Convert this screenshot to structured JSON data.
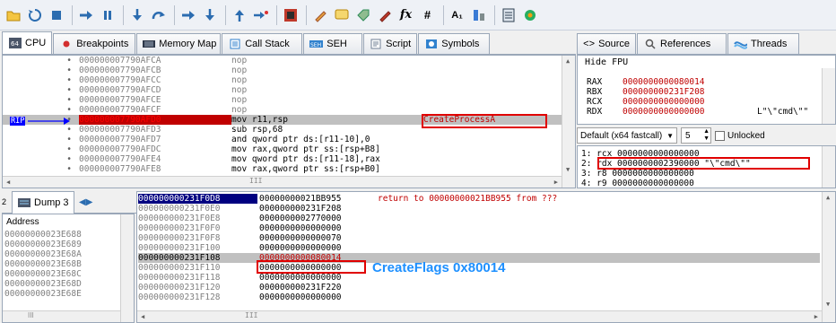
{
  "toolbar": {
    "icons": [
      "open-icon",
      "restart-icon",
      "stop-icon",
      "run-icon",
      "pause-icon",
      "step-into-icon",
      "step-over-icon",
      "trace-into-icon",
      "trace-over-icon",
      "execute-till-return-icon",
      "run-to-user-code-icon",
      "scylla-icon",
      "patch-icon",
      "comment-icon",
      "label-icon",
      "bookmark-icon",
      "function-icon",
      "hash-icon",
      "font-icon",
      "strings-icon",
      "memory-icon",
      "settings-icon"
    ],
    "fx_label": "fx",
    "hash_label": "#",
    "font_label": "A₁"
  },
  "top_tabs": [
    {
      "label": "CPU",
      "icon": "cpu-icon",
      "active": true
    },
    {
      "label": "Breakpoints",
      "icon": "breakpoint-dot-icon"
    },
    {
      "label": "Memory Map",
      "icon": "memory-map-icon"
    },
    {
      "label": "Call Stack",
      "icon": "call-stack-icon"
    },
    {
      "label": "SEH",
      "icon": "seh-icon"
    },
    {
      "label": "Script",
      "icon": "script-icon"
    },
    {
      "label": "Symbols",
      "icon": "symbols-icon"
    },
    {
      "label": "Source",
      "icon": "source-icon"
    },
    {
      "label": "References",
      "icon": "references-icon"
    },
    {
      "label": "Threads",
      "icon": "threads-icon"
    }
  ],
  "disassembly": {
    "rip_label": "RIP",
    "rows": [
      {
        "addr": "000000007790AFCA",
        "instr": "nop",
        "comment": ""
      },
      {
        "addr": "000000007790AFCB",
        "instr": "nop",
        "comment": ""
      },
      {
        "addr": "000000007790AFCC",
        "instr": "nop",
        "comment": ""
      },
      {
        "addr": "000000007790AFCD",
        "instr": "nop",
        "comment": ""
      },
      {
        "addr": "000000007790AFCE",
        "instr": "nop",
        "comment": ""
      },
      {
        "addr": "000000007790AFCF",
        "instr": "nop",
        "comment": ""
      },
      {
        "addr": "000000007790AFD0",
        "instr": "mov r11,rsp",
        "comment": "CreateProcessA",
        "current": true
      },
      {
        "addr": "000000007790AFD3",
        "instr": "sub rsp,68",
        "comment": ""
      },
      {
        "addr": "000000007790AFD7",
        "instr": "and qword ptr ds:[r11-10],0",
        "comment": ""
      },
      {
        "addr": "000000007790AFDC",
        "instr": "mov rax,qword ptr ss:[rsp+B8]",
        "comment": ""
      },
      {
        "addr": "000000007790AFE4",
        "instr": "mov qword ptr ds:[r11-18],rax",
        "comment": ""
      },
      {
        "addr": "000000007790AFE8",
        "instr": "mov rax,qword ptr ss:[rsp+B0]",
        "comment": ""
      }
    ],
    "hscroll_label": "III"
  },
  "registers": {
    "hide_fpu_label": "Hide FPU",
    "rows": [
      {
        "name": "RAX",
        "value": "0000000000080014",
        "extra": ""
      },
      {
        "name": "RBX",
        "value": "000000000231F208",
        "extra": ""
      },
      {
        "name": "RCX",
        "value": "0000000000000000",
        "extra": ""
      },
      {
        "name": "RDX",
        "value": "0000000000000000",
        "extra": "L\"\\\"cmd\\\"\""
      }
    ]
  },
  "args": {
    "convention": "Default (x64 fastcall)",
    "count": "5",
    "unlocked_label": "Unlocked",
    "rows": [
      "1: rcx 0000000000000000",
      "2: rdx 0000000002390000 \"\\\"cmd\\\"\"",
      "3: r8 0000000000000000",
      "4: r9 0000000000000000"
    ]
  },
  "dump": {
    "tab_label": "Dump 3",
    "address_header": "Address",
    "addresses": [
      "00000000023E688",
      "00000000023E689",
      "00000000023E68A",
      "00000000023E68B",
      "00000000023E68C",
      "00000000023E68D",
      "00000000023E68E"
    ],
    "hscroll_label": "III"
  },
  "stack": {
    "rows": [
      {
        "addr": "000000000231F0D8",
        "value": "00000000021BB955",
        "comment": "return to 00000000021BB955 from ???",
        "selected": true
      },
      {
        "addr": "000000000231F0E0",
        "value": "000000000231F208",
        "comment": ""
      },
      {
        "addr": "000000000231F0E8",
        "value": "0000000002770000",
        "comment": ""
      },
      {
        "addr": "000000000231F0F0",
        "value": "0000000000000000",
        "comment": ""
      },
      {
        "addr": "000000000231F0F8",
        "value": "0000000000000070",
        "comment": ""
      },
      {
        "addr": "000000000231F100",
        "value": "0000000000000000",
        "comment": ""
      },
      {
        "addr": "000000000231F108",
        "value": "0000000000080014",
        "comment": "",
        "highlight": true
      },
      {
        "addr": "000000000231F110",
        "value": "0000000000000000",
        "comment": ""
      },
      {
        "addr": "000000000231F118",
        "value": "0000000000000000",
        "comment": ""
      },
      {
        "addr": "000000000231F120",
        "value": "000000000231F220",
        "comment": ""
      },
      {
        "addr": "000000000231F128",
        "value": "0000000000000000",
        "comment": ""
      }
    ],
    "annotation": "CreateFlags 0x80014",
    "hscroll_label": "III"
  },
  "colors": {
    "accent_blue": "#0000ff",
    "annotation_blue": "#1e90ff",
    "red": "#c00000",
    "highlight_box": "#e00000"
  }
}
